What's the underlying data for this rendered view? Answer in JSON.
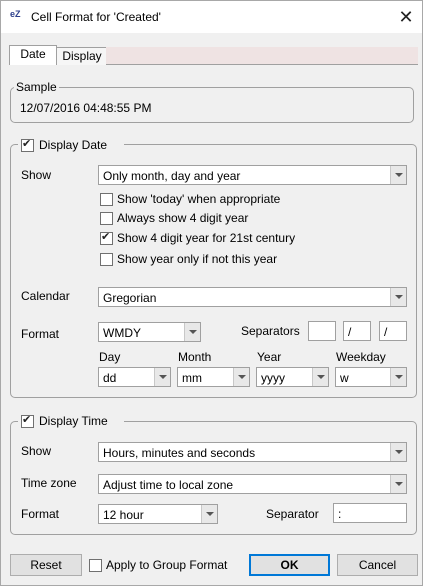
{
  "window": {
    "title": "Cell Format for 'Created'",
    "icon_text": "eZ",
    "close_glyph": "✕"
  },
  "tabs": [
    {
      "label": "Date",
      "active": true
    },
    {
      "label": "Display",
      "active": false
    }
  ],
  "sample": {
    "legend": "Sample",
    "value": "12/07/2016 04:48:55 PM"
  },
  "display_date": {
    "legend": "Display Date",
    "checked": true,
    "show_label": "Show",
    "show_value": "Only month, day and year",
    "options": [
      {
        "label": "Show 'today' when appropriate",
        "checked": false
      },
      {
        "label": "Always show 4 digit year",
        "checked": false
      },
      {
        "label": "Show 4 digit year for 21st century",
        "checked": true
      },
      {
        "label": "Show year only if not this year",
        "checked": false
      }
    ],
    "calendar_label": "Calendar",
    "calendar_value": "Gregorian",
    "format_label": "Format",
    "format_value": "WMDY",
    "separators_label": "Separators",
    "separators": [
      "",
      "/",
      "/"
    ],
    "day_label": "Day",
    "day_value": "dd",
    "month_label": "Month",
    "month_value": "mm",
    "year_label": "Year",
    "year_value": "yyyy",
    "weekday_label": "Weekday",
    "weekday_value": "w"
  },
  "display_time": {
    "legend": "Display Time",
    "checked": true,
    "show_label": "Show",
    "show_value": "Hours, minutes and seconds",
    "timezone_label": "Time zone",
    "timezone_value": "Adjust time to local zone",
    "format_label": "Format",
    "format_value": "12 hour",
    "separator_label": "Separator",
    "separator_value": ":"
  },
  "footer": {
    "reset": "Reset",
    "apply_group": "Apply to Group Format",
    "apply_checked": false,
    "ok": "OK",
    "cancel": "Cancel"
  }
}
